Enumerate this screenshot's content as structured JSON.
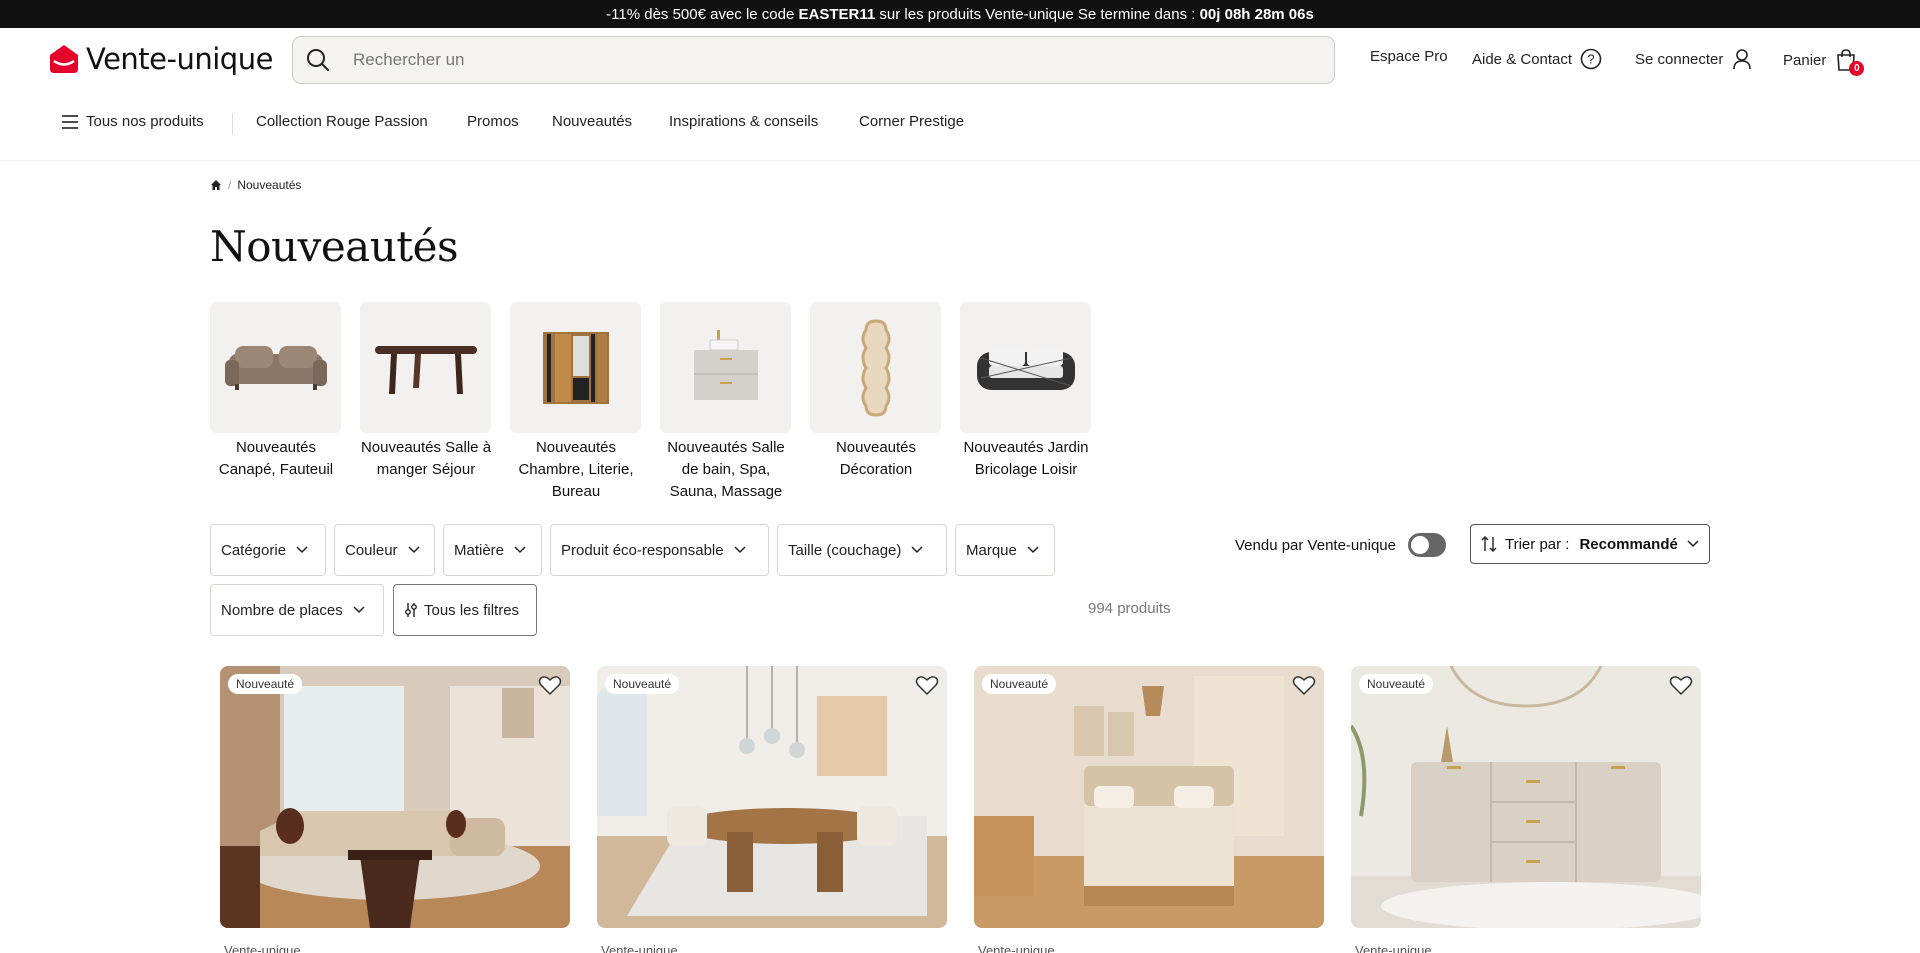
{
  "promo": {
    "prefix": "-11% dès 500€ avec le code ",
    "code": "EASTER11",
    "middle": " sur les produits Vente-unique Se termine dans : ",
    "countdown": "00j 08h 28m 06s"
  },
  "header": {
    "logo_text": "Vente-unique",
    "search_placeholder": "Rechercher un",
    "espace_pro": "Espace Pro",
    "aide_contact": "Aide & Contact",
    "se_connecter": "Se connecter",
    "panier": "Panier",
    "cart_count": "0"
  },
  "menu": {
    "all_products": "Tous nos produits",
    "items": [
      "Collection Rouge Passion",
      "Promos",
      "Nouveautés",
      "Inspirations & conseils",
      "Corner Prestige"
    ]
  },
  "breadcrumb": {
    "current": "Nouveautés"
  },
  "page_title": "Nouveautés",
  "categories": [
    {
      "label": "Nouveautés Canapé, Fauteuil",
      "icon": "sofa-icon"
    },
    {
      "label": "Nouveautés Salle à manger Séjour",
      "icon": "table-icon"
    },
    {
      "label": "Nouveautés Chambre, Literie, Bureau",
      "icon": "wardrobe-icon"
    },
    {
      "label": "Nouveautés Salle de bain, Spa, Sauna, Massage",
      "icon": "vanity-icon"
    },
    {
      "label": "Nouveautés Décoration",
      "icon": "mirror-icon"
    },
    {
      "label": "Nouveautés Jardin Bricolage Loisir",
      "icon": "garden-sofa-icon"
    }
  ],
  "filters": {
    "row1": [
      "Catégorie",
      "Couleur",
      "Matière",
      "Produit éco-responsable",
      "Taille (couchage)",
      "Marque"
    ],
    "places": "Nombre de places",
    "all_filters": "Tous les filtres",
    "count": "994 produits",
    "vendu_par": "Vendu par Vente-unique",
    "sort_label": "Trier par :",
    "sort_value": "Recommandé"
  },
  "products": [
    {
      "badge": "Nouveauté",
      "brand": "Vente-unique",
      "scene": "living-room"
    },
    {
      "badge": "Nouveauté",
      "brand": "Vente-unique",
      "scene": "dining-room"
    },
    {
      "badge": "Nouveauté",
      "brand": "Vente-unique",
      "scene": "bedroom"
    },
    {
      "badge": "Nouveauté",
      "brand": "Vente-unique",
      "scene": "sideboard"
    }
  ],
  "colors": {
    "brand_red": "#e4002b",
    "banner_bg": "#111111"
  }
}
